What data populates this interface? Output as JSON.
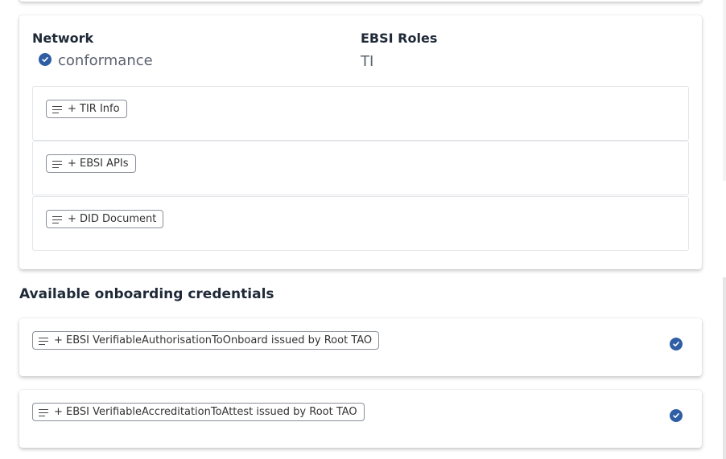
{
  "main": {
    "network_label": "Network",
    "network_value": "conformance",
    "roles_label": "EBSI Roles",
    "roles_value": "TI",
    "sections": [
      {
        "label": "+ TIR Info"
      },
      {
        "label": "+ EBSI APIs"
      },
      {
        "label": "+ DID Document"
      }
    ]
  },
  "credentials": {
    "title": "Available onboarding credentials",
    "items": [
      {
        "label": "+ EBSI VerifiableAuthorisationToOnboard issued by Root TAO",
        "status_icon": "check-circle-icon"
      },
      {
        "label": "+ EBSI VerifiableAccreditationToAttest issued by Root TAO",
        "status_icon": "check-circle-icon"
      }
    ]
  },
  "colors": {
    "accent": "#2f5ea5",
    "chip_border": "#8a8f98",
    "section_border": "#e3e5e8"
  }
}
